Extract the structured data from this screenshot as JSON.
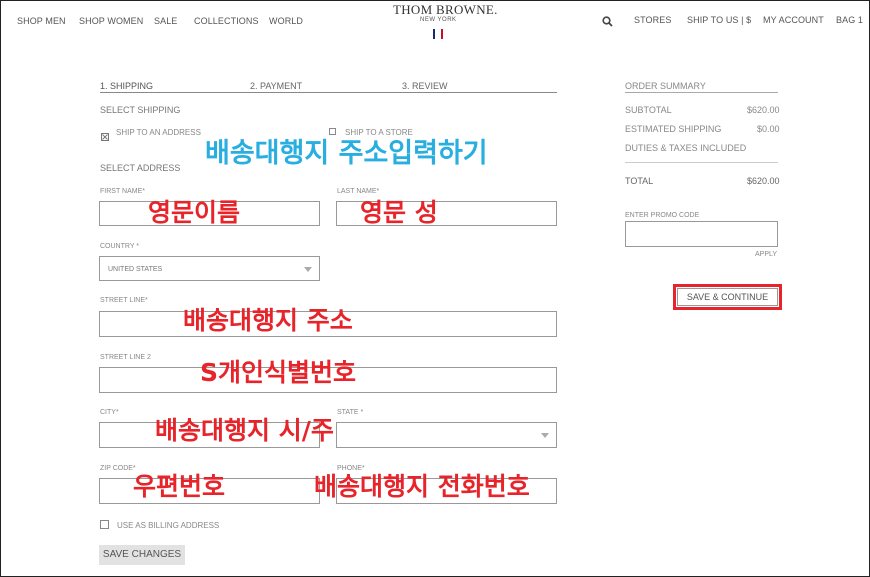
{
  "header": {
    "nav_left": [
      "SHOP MEN",
      "SHOP WOMEN",
      "SALE",
      "COLLECTIONS",
      "WORLD"
    ],
    "brand": "THOM BROWNE.",
    "brand_sub": "NEW YORK",
    "nav_right": [
      "STORES",
      "SHIP TO US | $",
      "MY ACCOUNT",
      "BAG 1"
    ],
    "flag_colors": [
      "#1b2a6b",
      "#ffffff",
      "#c8102e"
    ]
  },
  "steps": [
    "1. SHIPPING",
    "2. PAYMENT",
    "3. REVIEW"
  ],
  "shipping": {
    "select_shipping": "SELECT SHIPPING",
    "ship_to_address": "SHIP TO AN ADDRESS",
    "ship_to_store": "SHIP TO A STORE",
    "select_address": "SELECT ADDRESS"
  },
  "form": {
    "first_name": "FIRST NAME*",
    "last_name": "LAST NAME*",
    "country": "COUNTRY *",
    "country_value": "UNITED STATES",
    "street_line": "STREET LINE*",
    "street_line_2": "STREET LINE 2",
    "city": "CITY*",
    "state": "STATE *",
    "zip": "ZIP CODE*",
    "phone": "PHONE*",
    "use_as_billing": "USE AS BILLING ADDRESS",
    "save_changes": "SAVE CHANGES"
  },
  "summary": {
    "title": "ORDER SUMMARY",
    "subtotal_label": "SUBTOTAL",
    "subtotal_value": "$620.00",
    "shipping_label": "ESTIMATED SHIPPING",
    "shipping_value": "$0.00",
    "duties": "DUTIES & TAXES INCLUDED",
    "total_label": "TOTAL",
    "total_value": "$620.00",
    "promo_label": "ENTER PROMO CODE",
    "apply": "APPLY",
    "save_continue": "SAVE & CONTINUE"
  },
  "annotations": {
    "heading": "배송대행지 주소입력하기",
    "first_name": "영문이름",
    "last_name": "영문 성",
    "street": "배송대행지 주소",
    "street2": "S개인식별번호",
    "city_state": "배송대행지 시/주",
    "zip": "우편번호",
    "phone": "배송대행지 전화번호",
    "colors": {
      "red": "#e8242b",
      "blue": "#29aee0"
    }
  }
}
